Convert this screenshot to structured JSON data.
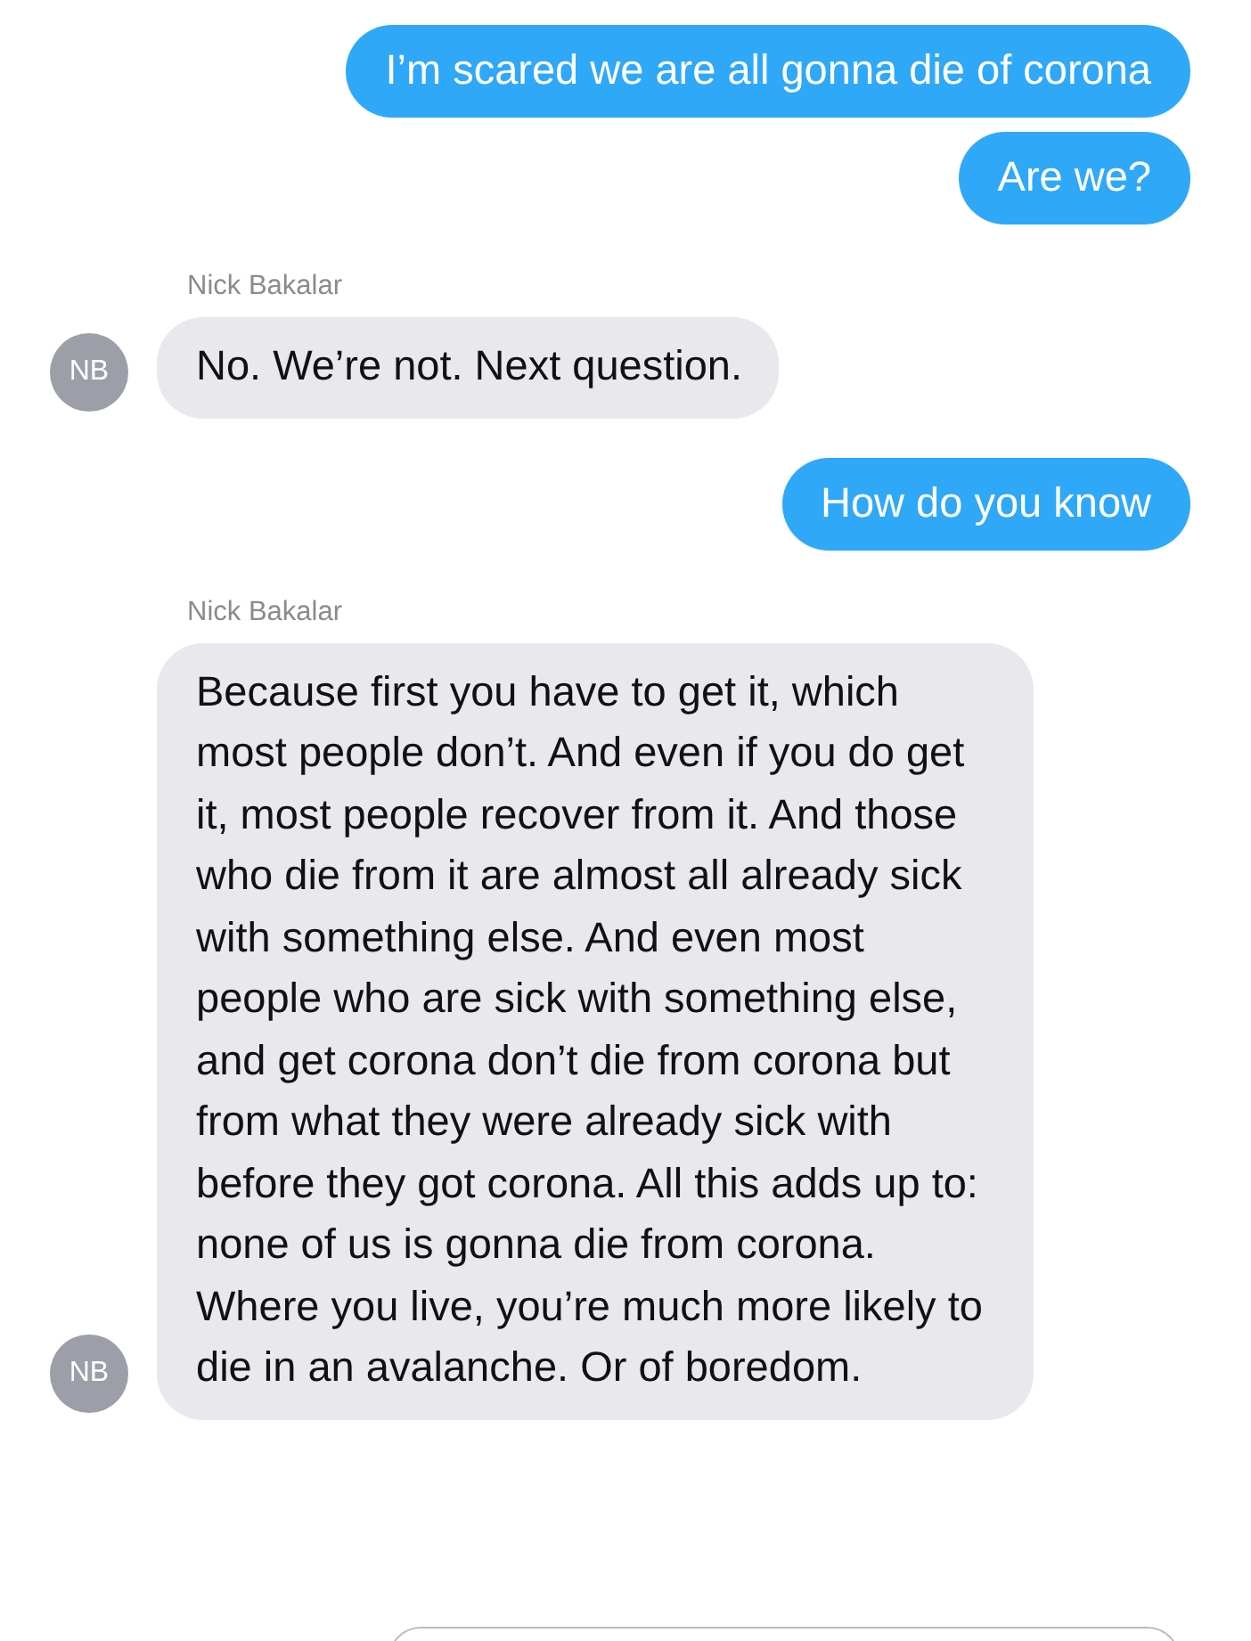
{
  "messages": [
    {
      "kind": "sent",
      "text": "I’m scared we are all gonna die of corona"
    },
    {
      "kind": "sent",
      "text": "Are we?"
    },
    {
      "kind": "received",
      "sender": "Nick Bakalar",
      "avatar": "NB",
      "text": "No. We’re not. Next question."
    },
    {
      "kind": "sent",
      "text": "How do you know"
    },
    {
      "kind": "received",
      "sender": "Nick Bakalar",
      "avatar": "NB",
      "text": "Because first you have to get it, which most people don’t. And even if you do get it, most people recover from it. And those who die from it are almost all already sick with something else. And even most people who are sick with something else, and get corona don’t die from corona but from what they were already sick with before they got corona. All this adds up to: none of us is gonna die from corona. Where you live, you’re much more likely to die in an avalanche. Or of boredom."
    }
  ]
}
